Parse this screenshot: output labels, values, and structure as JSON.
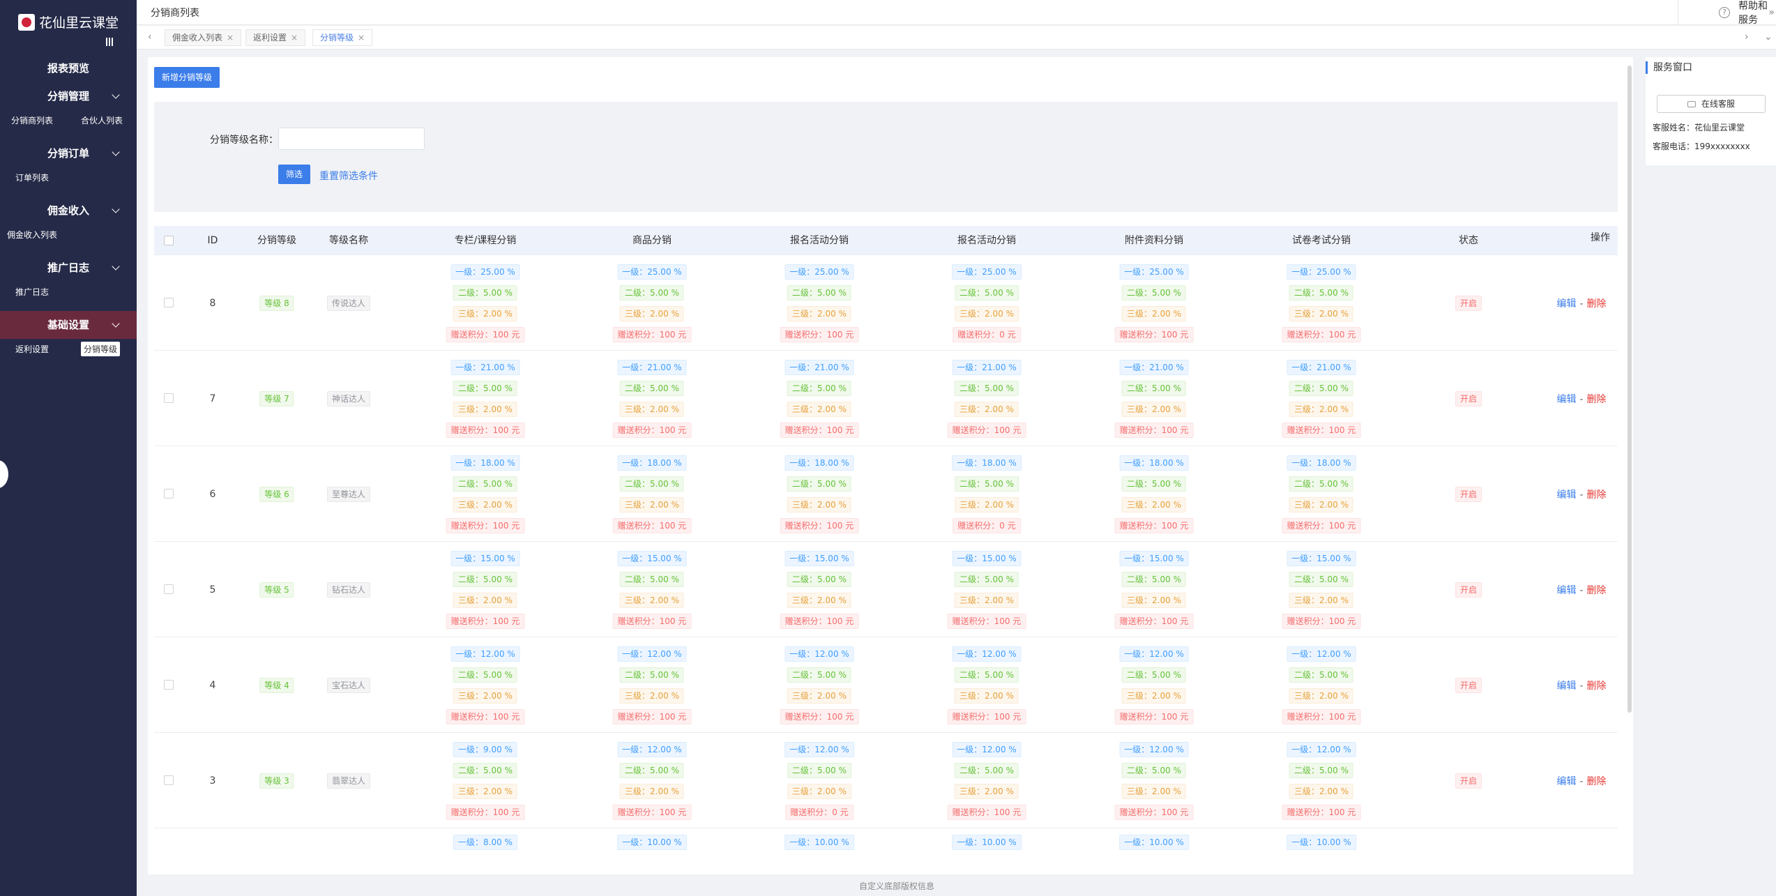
{
  "app": {
    "title": "花仙里云课堂"
  },
  "sidebar": {
    "groups": [
      {
        "title": "报表预览",
        "items": []
      },
      {
        "title": "分销管理",
        "items": [
          "分销商列表",
          "合伙人列表"
        ]
      },
      {
        "title": "分销订单",
        "items": [
          "订单列表"
        ]
      },
      {
        "title": "佣金收入",
        "items": [
          "佣金收入列表"
        ]
      },
      {
        "title": "推广日志",
        "items": [
          "推广日志"
        ]
      },
      {
        "title": "基础设置",
        "items": [
          "返利设置",
          "分销等级"
        ]
      }
    ]
  },
  "topbar": {
    "breadcrumb": "分销商列表",
    "help": "帮助和服务"
  },
  "tabs": [
    {
      "label": "佣金收入列表"
    },
    {
      "label": "返利设置"
    },
    {
      "label": "分销等级",
      "active": true
    }
  ],
  "toolbar": {
    "add_label": "新增分销等级"
  },
  "filter": {
    "name_label": "分销等级名称：",
    "name_value": "",
    "submit": "筛选",
    "reset": "重置筛选条件"
  },
  "table": {
    "headers": [
      "ID",
      "分销等级",
      "等级名称",
      "专栏/课程分销",
      "商品分销",
      "报名活动分销",
      "报名活动分销",
      "附件资料分销",
      "试卷考试分销",
      "状态",
      "操作"
    ],
    "prefixes": {
      "l1": "一级：",
      "l2": "二级：",
      "l3": "三级：",
      "pts": "赠送积分："
    },
    "rows": [
      {
        "id": "8",
        "level": "等级 8",
        "name": "传说达人",
        "status": "开启",
        "cols": [
          [
            "25.00 %",
            "5.00 %",
            "2.00 %",
            "100 元"
          ],
          [
            "25.00 %",
            "5.00 %",
            "2.00 %",
            "100 元"
          ],
          [
            "25.00 %",
            "5.00 %",
            "2.00 %",
            "100 元"
          ],
          [
            "25.00 %",
            "5.00 %",
            "2.00 %",
            "0 元"
          ],
          [
            "25.00 %",
            "5.00 %",
            "2.00 %",
            "100 元"
          ],
          [
            "25.00 %",
            "5.00 %",
            "2.00 %",
            "100 元"
          ]
        ]
      },
      {
        "id": "7",
        "level": "等级 7",
        "name": "神话达人",
        "status": "开启",
        "cols": [
          [
            "21.00 %",
            "5.00 %",
            "2.00 %",
            "100 元"
          ],
          [
            "21.00 %",
            "5.00 %",
            "2.00 %",
            "100 元"
          ],
          [
            "21.00 %",
            "5.00 %",
            "2.00 %",
            "100 元"
          ],
          [
            "21.00 %",
            "5.00 %",
            "2.00 %",
            "100 元"
          ],
          [
            "21.00 %",
            "5.00 %",
            "2.00 %",
            "100 元"
          ],
          [
            "21.00 %",
            "5.00 %",
            "2.00 %",
            "100 元"
          ]
        ]
      },
      {
        "id": "6",
        "level": "等级 6",
        "name": "至尊达人",
        "status": "开启",
        "cols": [
          [
            "18.00 %",
            "5.00 %",
            "2.00 %",
            "100 元"
          ],
          [
            "18.00 %",
            "5.00 %",
            "2.00 %",
            "100 元"
          ],
          [
            "18.00 %",
            "5.00 %",
            "2.00 %",
            "100 元"
          ],
          [
            "18.00 %",
            "5.00 %",
            "2.00 %",
            "0 元"
          ],
          [
            "18.00 %",
            "5.00 %",
            "2.00 %",
            "100 元"
          ],
          [
            "18.00 %",
            "5.00 %",
            "2.00 %",
            "100 元"
          ]
        ]
      },
      {
        "id": "5",
        "level": "等级 5",
        "name": "钻石达人",
        "status": "开启",
        "cols": [
          [
            "15.00 %",
            "5.00 %",
            "2.00 %",
            "100 元"
          ],
          [
            "15.00 %",
            "5.00 %",
            "2.00 %",
            "100 元"
          ],
          [
            "15.00 %",
            "5.00 %",
            "2.00 %",
            "100 元"
          ],
          [
            "15.00 %",
            "5.00 %",
            "2.00 %",
            "100 元"
          ],
          [
            "15.00 %",
            "5.00 %",
            "2.00 %",
            "100 元"
          ],
          [
            "15.00 %",
            "5.00 %",
            "2.00 %",
            "100 元"
          ]
        ]
      },
      {
        "id": "4",
        "level": "等级 4",
        "name": "宝石达人",
        "status": "开启",
        "cols": [
          [
            "12.00 %",
            "5.00 %",
            "2.00 %",
            "100 元"
          ],
          [
            "12.00 %",
            "5.00 %",
            "2.00 %",
            "100 元"
          ],
          [
            "12.00 %",
            "5.00 %",
            "2.00 %",
            "100 元"
          ],
          [
            "12.00 %",
            "5.00 %",
            "2.00 %",
            "100 元"
          ],
          [
            "12.00 %",
            "5.00 %",
            "2.00 %",
            "100 元"
          ],
          [
            "12.00 %",
            "5.00 %",
            "2.00 %",
            "100 元"
          ]
        ]
      },
      {
        "id": "3",
        "level": "等级 3",
        "name": "翡翠达人",
        "status": "开启",
        "cols": [
          [
            "9.00 %",
            "5.00 %",
            "2.00 %",
            "100 元"
          ],
          [
            "12.00 %",
            "5.00 %",
            "2.00 %",
            "100 元"
          ],
          [
            "12.00 %",
            "5.00 %",
            "2.00 %",
            "0 元"
          ],
          [
            "12.00 %",
            "5.00 %",
            "2.00 %",
            "100 元"
          ],
          [
            "12.00 %",
            "5.00 %",
            "2.00 %",
            "100 元"
          ],
          [
            "12.00 %",
            "5.00 %",
            "2.00 %",
            "100 元"
          ]
        ]
      },
      {
        "id": "",
        "level": "",
        "name": "",
        "status": "",
        "cols": [
          [
            "8.00 %",
            "",
            "",
            ""
          ],
          [
            "10.00 %",
            "",
            "",
            ""
          ],
          [
            "10.00 %",
            "",
            "",
            ""
          ],
          [
            "10.00 %",
            "",
            "",
            ""
          ],
          [
            "10.00 %",
            "",
            "",
            ""
          ],
          [
            "10.00 %",
            "",
            "",
            ""
          ]
        ]
      }
    ],
    "actions": {
      "edit": "编辑",
      "sep": "-",
      "del": "删除"
    }
  },
  "footer": "自定义底部版权信息",
  "service": {
    "title": "服务窗口",
    "button": "在线客服",
    "name_label": "客服姓名：",
    "name": "花仙里云课堂",
    "phone_label": "客服电话：",
    "phone": "199xxxxxxxx"
  }
}
